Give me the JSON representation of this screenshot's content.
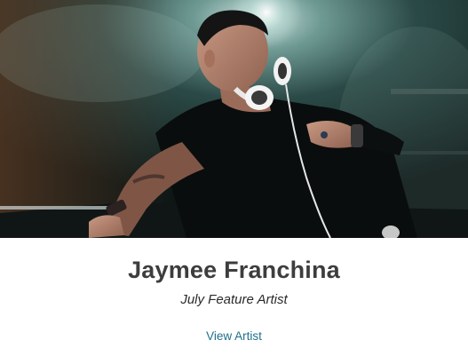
{
  "feature": {
    "name": "Jaymee Franchina",
    "subtitle": "July Feature Artist",
    "link_label": "View Artist",
    "link_color": "#1f6f8b",
    "photo_description_icon": "dj-photo"
  }
}
